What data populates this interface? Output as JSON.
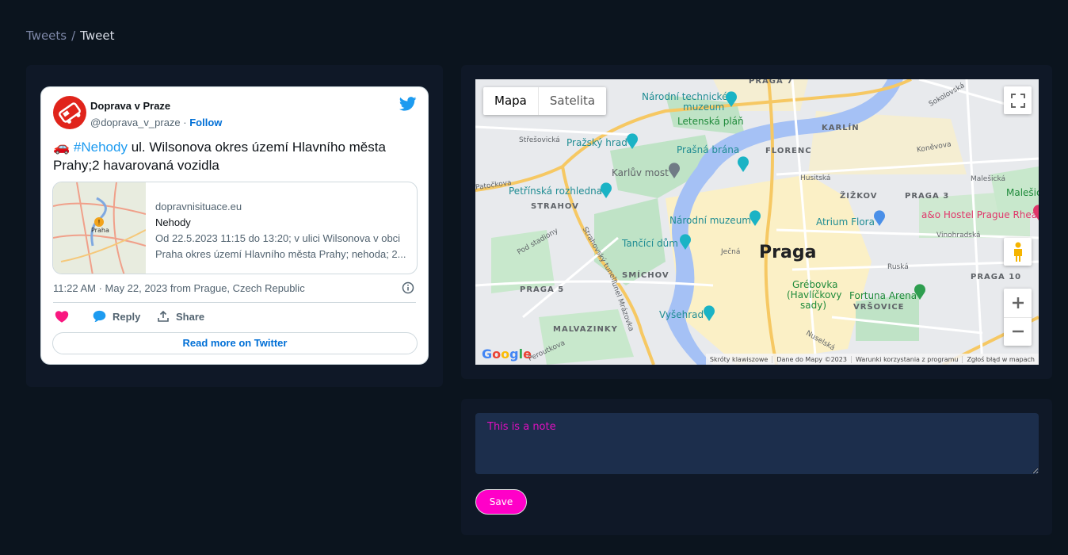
{
  "breadcrumb": {
    "parent": "Tweets",
    "separator": "/",
    "current": "Tweet"
  },
  "tweet": {
    "author_name": "Doprava v Praze",
    "handle": "@doprava_v_praze",
    "handle_sep": " · ",
    "follow_label": "Follow",
    "text_emoji": "🚗",
    "hashtag": "#Nehody",
    "text_rest": " ul. Wilsonova okres území Hlavního města Prahy;2 havarovaná vozidla",
    "link_card": {
      "domain": "dopravnisituace.eu",
      "title": "Nehody",
      "desc_line1": "Od 22.5.2023 11:15 do 13:20; v ulici Wilsonova v obci",
      "desc_line2": "Praha okres území Hlavního města Prahy; nehoda; 2...",
      "thumb_label": "Praha"
    },
    "meta": "11:22 AM · May 22, 2023 from Prague, Czech Republic",
    "actions": {
      "reply": "Reply",
      "share": "Share"
    },
    "read_more": "Read more on Twitter",
    "colors": {
      "like": "#f91880",
      "reply": "#1d9bf0",
      "link": "#006fd6",
      "bird": "#1d9bf0"
    }
  },
  "map": {
    "type_map": "Mapa",
    "type_satellite": "Satelita",
    "labels": {
      "ntm": "Národní technické",
      "ntm2": "muzeum",
      "letenska": "Letenská pláň",
      "karlin": "KARLÍN",
      "hrad": "Pražský hrad",
      "prasna": "Prašná brána",
      "florenc": "FLORENC",
      "strese": "Střešovická",
      "karluv": "Karlův most",
      "petrin": "Petřínská rozhledna",
      "patockova": "Patočkova",
      "strahov": "STRAHOV",
      "narodni": "Národní muzeum",
      "praga": "Praga",
      "tancici": "Tančící dům",
      "smichov": "SMÍCHOV",
      "praga5": "PRAGA 5",
      "vysehrad": "Vyšehrad",
      "malvazinky": "MALVAZINKY",
      "zizkov": "ŽIŽKOV",
      "praga3": "PRAGA 3",
      "atrium": "Atrium Flora",
      "hostel": "a&o Hostel Prague Rhea",
      "grebovka": "Grébovka",
      "grebovka2": "(Havlíčkovy",
      "grebovka3": "sady)",
      "fortuna": "Fortuna Arena",
      "vrsovice": "VRŠOVICE",
      "praga10": "PRAGA 10",
      "konevova": "Koněvova",
      "husitska": "Husitská",
      "malesicka": "Malešická",
      "malesice": "Malešic",
      "vinohradska": "Vinohradská",
      "ruska": "Ruská",
      "sokolovska": "Sokolovská",
      "praga7": "PRAGA 7",
      "pod_stadiony": "Pod stadiony",
      "strahovsky": "Strahovský tunel",
      "mrazovka": "Tunel Mrázovka",
      "nuselska": "Nuselská",
      "peroutkova": "Peroutkova",
      "jecna": "Ječná"
    },
    "footer": [
      "Skróty klawiszowe",
      "Dane do Mapy ©2023",
      "Warunki korzystania z programu",
      "Zgłoś błąd w mapach"
    ],
    "google": "Google"
  },
  "note": {
    "value": "This is a note",
    "save_label": "Save"
  }
}
